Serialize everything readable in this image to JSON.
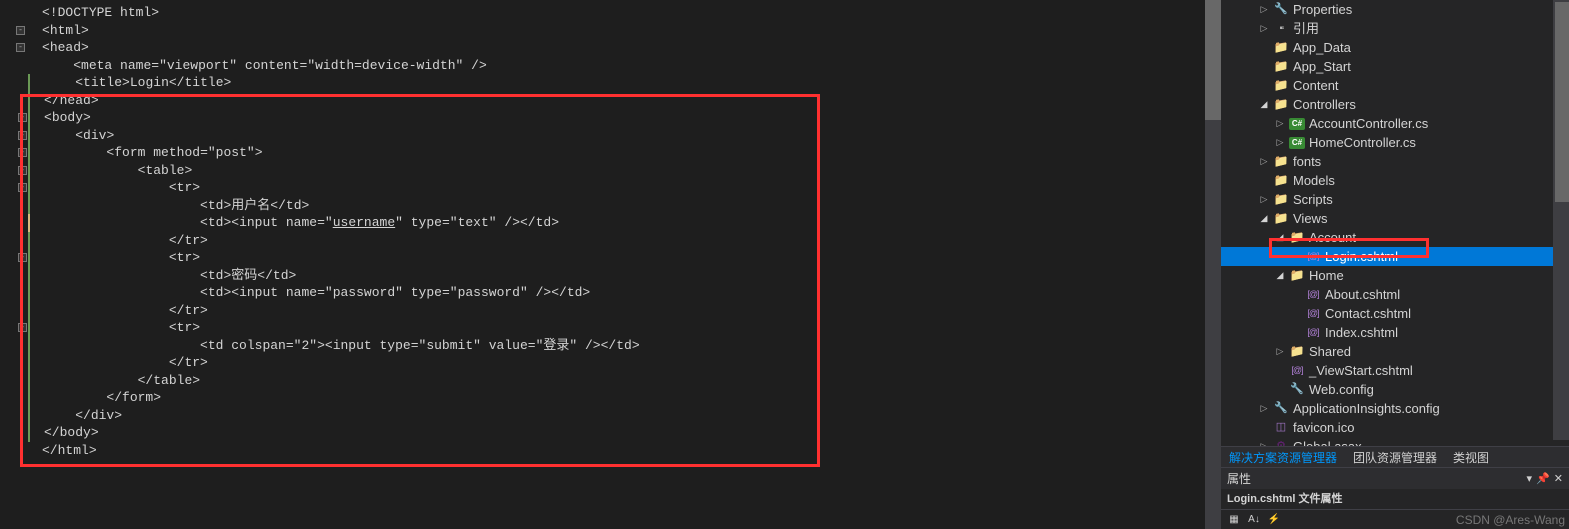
{
  "editor": {
    "lines": [
      {
        "i": 0,
        "fold": null,
        "bar": null,
        "html": "<span class='gray'>&lt;!</span><span class='blue'>DOCTYPE</span> <span class='attr'>html</span><span class='gray'>&gt;</span>"
      },
      {
        "i": 1,
        "fold": null,
        "bar": null,
        "html": ""
      },
      {
        "i": 2,
        "fold": "open",
        "bar": null,
        "html": "<span class='gray'>&lt;</span><span class='blue'>html</span><span class='gray'>&gt;</span>"
      },
      {
        "i": 3,
        "fold": "open",
        "bar": null,
        "html": "<span class='gray'>&lt;</span><span class='blue'>head</span><span class='gray'>&gt;</span>"
      },
      {
        "i": 4,
        "fold": null,
        "bar": null,
        "html": "    <span class='gray'>&lt;</span><span class='blue'>meta</span> <span class='attr'>name</span><span class='gray'>=</span><span class='string'>\"viewport\"</span> <span class='attr'>content</span><span class='gray'>=</span><span class='string'>\"width=device-width\"</span> <span class='gray'>/&gt;</span>"
      },
      {
        "i": 5,
        "fold": null,
        "bar": "g",
        "html": "    <span class='gray'>&lt;</span><span class='blue'>title</span><span class='gray'>&gt;</span><span class='txt'>Login</span><span class='gray'>&lt;/</span><span class='blue'>title</span><span class='gray'>&gt;</span>"
      },
      {
        "i": 6,
        "fold": null,
        "bar": "g",
        "html": "<span class='gray'>&lt;/</span><span class='blue'>head</span><span class='gray'>&gt;</span>"
      },
      {
        "i": 7,
        "fold": "open",
        "bar": "g",
        "html": "<span class='gray'>&lt;</span><span class='blue'>body</span><span class='gray'>&gt;</span>"
      },
      {
        "i": 8,
        "fold": "open",
        "bar": "g",
        "html": "    <span class='gray'>&lt;</span><span class='blue'>div</span><span class='gray'>&gt;</span>"
      },
      {
        "i": 9,
        "fold": "open",
        "bar": "g",
        "html": "        <span class='gray'>&lt;</span><span class='blue'>form</span> <span class='attr'>method</span><span class='gray'>=</span><span class='string'>\"post\"</span><span class='gray'>&gt;</span>"
      },
      {
        "i": 10,
        "fold": "open",
        "bar": "g",
        "html": "            <span class='gray'>&lt;</span><span class='blue'>table</span><span class='gray'>&gt;</span>"
      },
      {
        "i": 11,
        "fold": "open",
        "bar": "g",
        "html": "                <span class='gray'>&lt;</span><span class='blue'>tr</span><span class='gray'>&gt;</span>"
      },
      {
        "i": 12,
        "fold": null,
        "bar": "g",
        "html": "                    <span class='gray'>&lt;</span><span class='blue'>td</span><span class='gray'>&gt;</span><span class='txt'>用户名</span><span class='gray'>&lt;/</span><span class='blue'>td</span><span class='gray'>&gt;</span>"
      },
      {
        "i": 13,
        "fold": null,
        "bar": "y",
        "html": "                    <span class='gray'>&lt;</span><span class='blue'>td</span><span class='gray'>&gt;&lt;</span><span class='blue'>input</span> <span class='attr'>name</span><span class='gray'>=</span><span class='string'>\"<u>username</u>\"</span> <span class='attr'>type</span><span class='gray'>=</span><span class='string'>\"text\"</span> <span class='gray'>/&gt;&lt;/</span><span class='blue'>td</span><span class='gray'>&gt;</span>"
      },
      {
        "i": 14,
        "fold": null,
        "bar": "g",
        "html": "                <span class='gray'>&lt;/</span><span class='blue'>tr</span><span class='gray'>&gt;</span>"
      },
      {
        "i": 15,
        "fold": "open",
        "bar": "g",
        "html": "                <span class='gray'>&lt;</span><span class='blue'>tr</span><span class='gray'>&gt;</span>"
      },
      {
        "i": 16,
        "fold": null,
        "bar": "g",
        "html": "                    <span class='gray'>&lt;</span><span class='blue'>td</span><span class='gray'>&gt;</span><span class='txt'>密码</span><span class='gray'>&lt;/</span><span class='blue'>td</span><span class='gray'>&gt;</span>"
      },
      {
        "i": 17,
        "fold": null,
        "bar": "g",
        "html": "                    <span class='gray'>&lt;</span><span class='blue'>td</span><span class='gray'>&gt;&lt;</span><span class='blue'>input</span> <span class='attr'>name</span><span class='gray'>=</span><span class='string'>\"password\"</span> <span class='attr'>type</span><span class='gray'>=</span><span class='string'>\"password\"</span> <span class='gray'>/&gt;&lt;/</span><span class='blue'>td</span><span class='gray'>&gt;</span>"
      },
      {
        "i": 18,
        "fold": null,
        "bar": "g",
        "html": "                <span class='gray'>&lt;/</span><span class='blue'>tr</span><span class='gray'>&gt;</span>"
      },
      {
        "i": 19,
        "fold": "open",
        "bar": "g",
        "html": "                <span class='gray'>&lt;</span><span class='blue'>tr</span><span class='gray'>&gt;</span>"
      },
      {
        "i": 20,
        "fold": null,
        "bar": "g",
        "html": "                    <span class='gray'>&lt;</span><span class='blue'>td</span> <span class='attr'>colspan</span><span class='gray'>=</span><span class='string'>\"2\"</span><span class='gray'>&gt;&lt;</span><span class='blue'>input</span> <span class='attr'>type</span><span class='gray'>=</span><span class='string'>\"submit\"</span> <span class='attr'>value</span><span class='gray'>=</span><span class='string'>\"登录\"</span> <span class='gray'>/&gt;&lt;/</span><span class='blue'>td</span><span class='gray'>&gt;</span>"
      },
      {
        "i": 21,
        "fold": null,
        "bar": "g",
        "html": "                <span class='gray'>&lt;/</span><span class='blue'>tr</span><span class='gray'>&gt;</span>"
      },
      {
        "i": 22,
        "fold": null,
        "bar": "g",
        "html": "            <span class='gray'>&lt;/</span><span class='blue'>table</span><span class='gray'>&gt;</span>"
      },
      {
        "i": 23,
        "fold": null,
        "bar": "g",
        "html": "        <span class='gray'>&lt;/</span><span class='blue'>form</span><span class='gray'>&gt;</span>"
      },
      {
        "i": 24,
        "fold": null,
        "bar": "g",
        "html": "    <span class='gray'>&lt;/</span><span class='blue'>div</span><span class='gray'>&gt;</span>"
      },
      {
        "i": 25,
        "fold": null,
        "bar": "g",
        "html": "<span class='gray'>&lt;/</span><span class='blue'>body</span><span class='gray'>&gt;</span>"
      },
      {
        "i": 26,
        "fold": null,
        "bar": null,
        "html": ""
      },
      {
        "i": 27,
        "fold": null,
        "bar": null,
        "html": "<span class='gray'>&lt;/</span><span class='blue'>html</span><span class='gray'>&gt;</span>"
      }
    ]
  },
  "explorer": {
    "tree": [
      {
        "d": 2,
        "a": "closed",
        "ic": "props",
        "label": "Properties"
      },
      {
        "d": 2,
        "a": "closed",
        "ic": "ref",
        "label": "引用"
      },
      {
        "d": 2,
        "a": "none",
        "ic": "folder",
        "label": "App_Data"
      },
      {
        "d": 2,
        "a": "none",
        "ic": "folder",
        "label": "App_Start"
      },
      {
        "d": 2,
        "a": "none",
        "ic": "folder",
        "label": "Content"
      },
      {
        "d": 2,
        "a": "open",
        "ic": "folder",
        "label": "Controllers"
      },
      {
        "d": 3,
        "a": "closed",
        "ic": "cs",
        "label": "AccountController.cs"
      },
      {
        "d": 3,
        "a": "closed",
        "ic": "cs",
        "label": "HomeController.cs"
      },
      {
        "d": 2,
        "a": "closed",
        "ic": "folder",
        "label": "fonts"
      },
      {
        "d": 2,
        "a": "none",
        "ic": "folder",
        "label": "Models"
      },
      {
        "d": 2,
        "a": "closed",
        "ic": "folder",
        "label": "Scripts"
      },
      {
        "d": 2,
        "a": "open",
        "ic": "folder",
        "label": "Views"
      },
      {
        "d": 3,
        "a": "open",
        "ic": "folder",
        "label": "Account"
      },
      {
        "d": 4,
        "a": "none",
        "ic": "cshtml",
        "label": "Login.cshtml",
        "sel": true
      },
      {
        "d": 3,
        "a": "open",
        "ic": "folder",
        "label": "Home"
      },
      {
        "d": 4,
        "a": "none",
        "ic": "cshtml",
        "label": "About.cshtml"
      },
      {
        "d": 4,
        "a": "none",
        "ic": "cshtml",
        "label": "Contact.cshtml"
      },
      {
        "d": 4,
        "a": "none",
        "ic": "cshtml",
        "label": "Index.cshtml"
      },
      {
        "d": 3,
        "a": "closed",
        "ic": "folder",
        "label": "Shared"
      },
      {
        "d": 3,
        "a": "none",
        "ic": "cshtml",
        "label": "_ViewStart.cshtml"
      },
      {
        "d": 3,
        "a": "none",
        "ic": "config",
        "label": "Web.config"
      },
      {
        "d": 2,
        "a": "closed",
        "ic": "config",
        "label": "ApplicationInsights.config"
      },
      {
        "d": 2,
        "a": "none",
        "ic": "ico",
        "label": "favicon.ico"
      },
      {
        "d": 2,
        "a": "closed",
        "ic": "asax",
        "label": "Global.asax"
      }
    ],
    "tabs": {
      "active": "解决方案资源管理器",
      "team": "团队资源管理器",
      "class": "类视图"
    }
  },
  "properties": {
    "title": "属性",
    "meta": "Login.cshtml 文件属性"
  },
  "watermark": "CSDN @Ares-Wang"
}
